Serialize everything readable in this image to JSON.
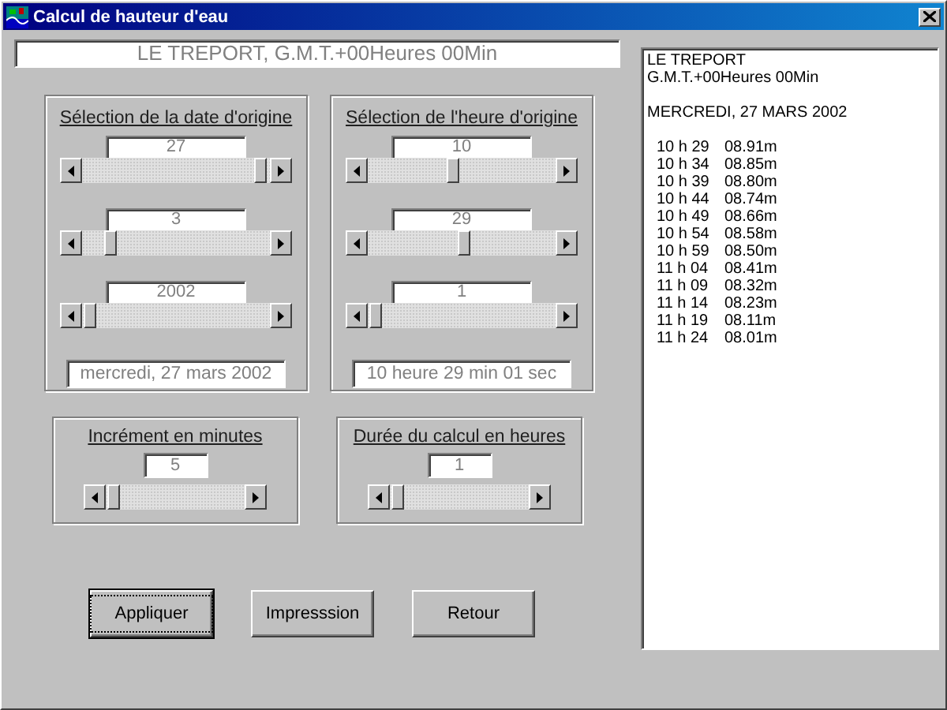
{
  "window": {
    "title": "Calcul de hauteur d'eau"
  },
  "header_field": {
    "value": "LE TREPORT, G.M.T.+00Heures 00Min"
  },
  "groups": [
    {
      "title": "Sélection de la date d'origine",
      "sliders": [
        {
          "value": "27",
          "level": 0.95
        },
        {
          "value": "3",
          "level": 0.15
        },
        {
          "value": "2002",
          "level": 0.04
        }
      ],
      "summary": "mercredi, 27 mars 2002"
    },
    {
      "title": "Sélection de l'heure d'origine",
      "sliders": [
        {
          "value": "10",
          "level": 0.45
        },
        {
          "value": "29",
          "level": 0.51
        },
        {
          "value": "1",
          "level": 0.04
        }
      ],
      "summary": "10 heure 29 min 01 sec"
    }
  ],
  "small_groups": [
    {
      "title": "Incrément en minutes",
      "value": "5",
      "level": 0.06
    },
    {
      "title": "Durée du calcul en heures",
      "value": "1",
      "level": 0.06
    }
  ],
  "buttons": [
    {
      "label": "Appliquer",
      "default": true
    },
    {
      "label": "Impresssion",
      "default": false
    },
    {
      "label": "Retour",
      "default": false
    }
  ],
  "results": {
    "header": [
      "LE TREPORT",
      "G.M.T.+00Heures 00Min"
    ],
    "date": "MERCREDI, 27 MARS 2002",
    "rows": [
      {
        "time": "10 h 29",
        "height": "08.91m"
      },
      {
        "time": "10 h 34",
        "height": "08.85m"
      },
      {
        "time": "10 h 39",
        "height": "08.80m"
      },
      {
        "time": "10 h 44",
        "height": "08.74m"
      },
      {
        "time": "10 h 49",
        "height": "08.66m"
      },
      {
        "time": "10 h 54",
        "height": "08.58m"
      },
      {
        "time": "10 h 59",
        "height": "08.50m"
      },
      {
        "time": "11 h 04",
        "height": "08.41m"
      },
      {
        "time": "11 h 09",
        "height": "08.32m"
      },
      {
        "time": "11 h 14",
        "height": "08.23m"
      },
      {
        "time": "11 h 19",
        "height": "08.11m"
      },
      {
        "time": "11 h 24",
        "height": "08.01m"
      }
    ]
  }
}
